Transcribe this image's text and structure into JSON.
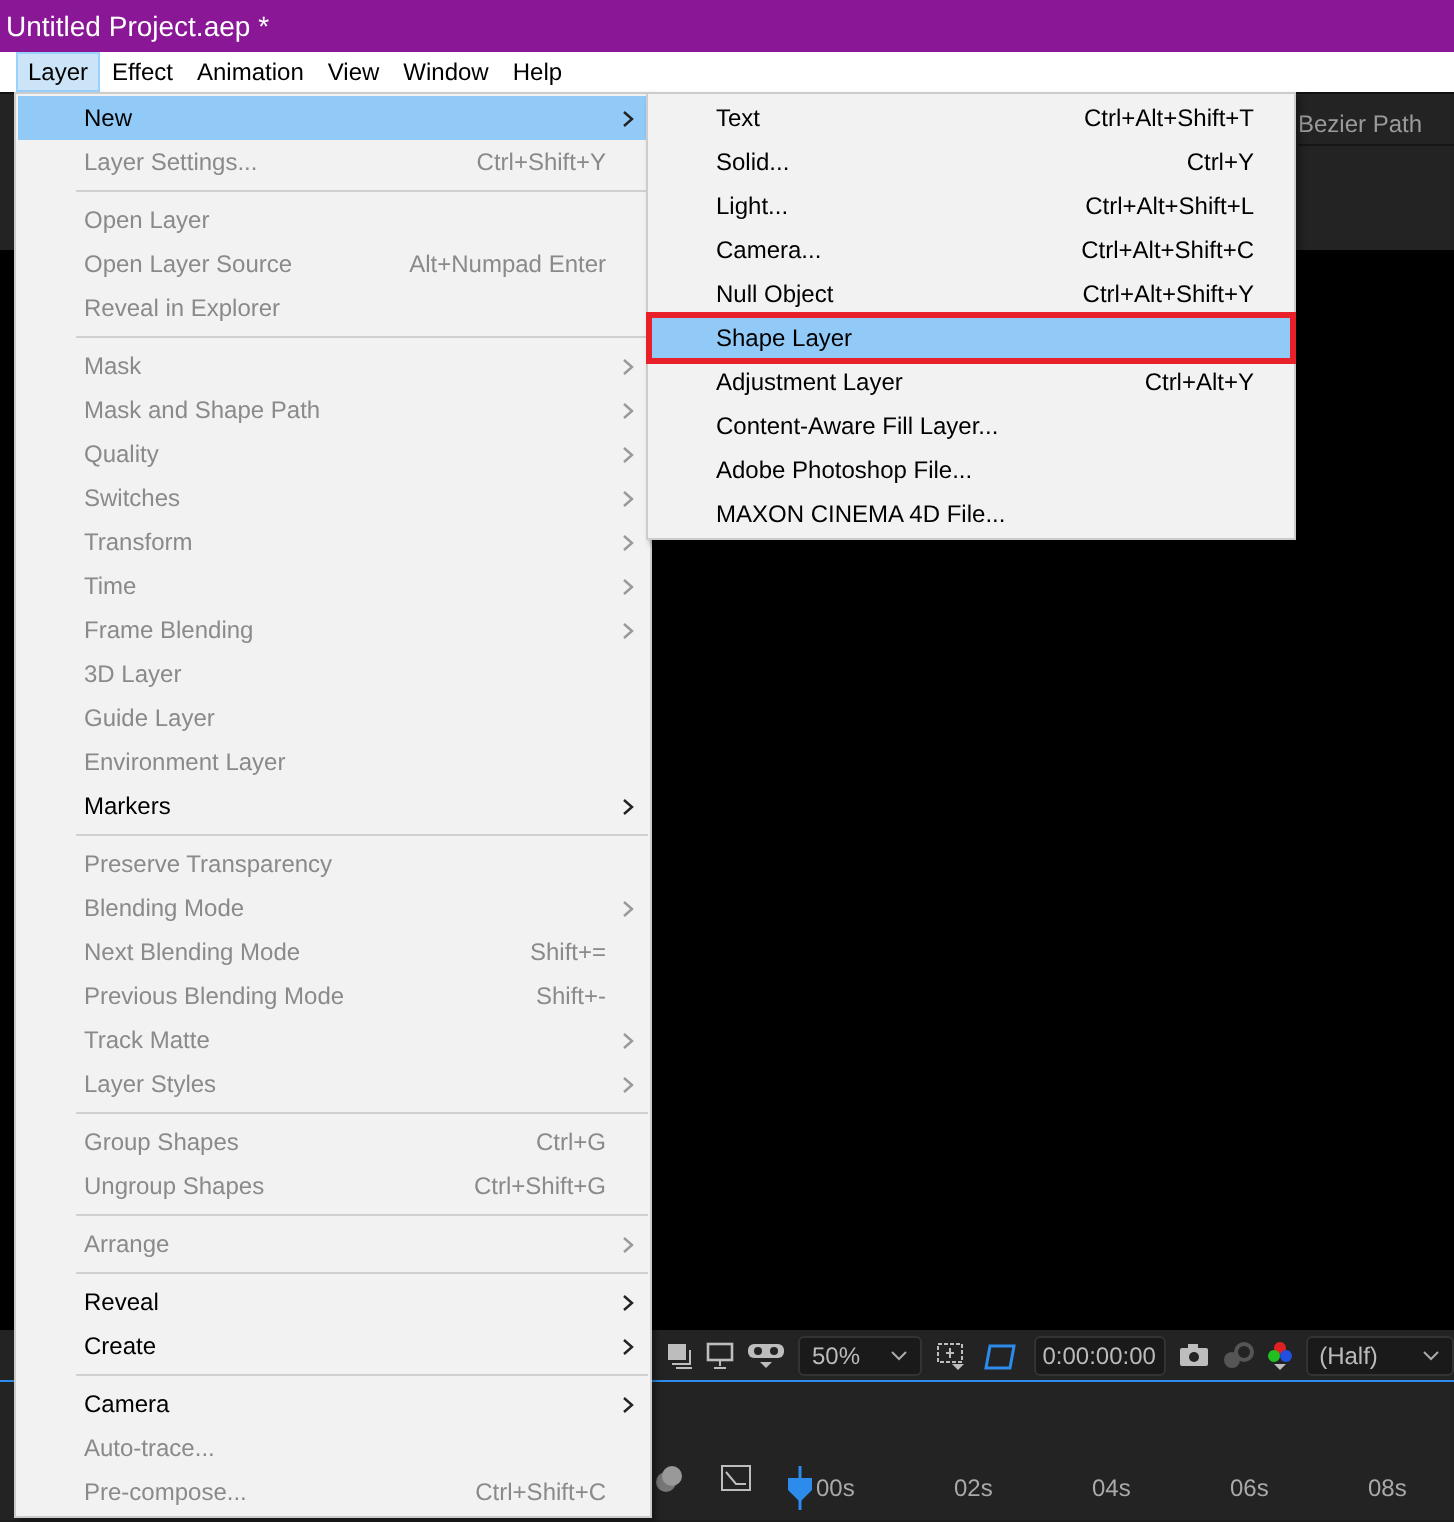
{
  "title_bar": {
    "title": "Untitled Project.aep *"
  },
  "menu_bar": [
    {
      "label": "Layer",
      "selected": true
    },
    {
      "label": "Effect",
      "selected": false
    },
    {
      "label": "Animation",
      "selected": false
    },
    {
      "label": "View",
      "selected": false
    },
    {
      "label": "Window",
      "selected": false
    },
    {
      "label": "Help",
      "selected": false
    }
  ],
  "layer_menu": [
    {
      "kind": "item",
      "label": "New",
      "submenu": true,
      "disabled": false,
      "selected": true
    },
    {
      "kind": "item",
      "label": "Layer Settings...",
      "shortcut": "Ctrl+Shift+Y",
      "disabled": true,
      "selected": false
    },
    {
      "kind": "separator"
    },
    {
      "kind": "item",
      "label": "Open Layer",
      "disabled": true,
      "selected": false
    },
    {
      "kind": "item",
      "label": "Open Layer Source",
      "shortcut": "Alt+Numpad Enter",
      "disabled": true,
      "selected": false
    },
    {
      "kind": "item",
      "label": "Reveal in Explorer",
      "disabled": true,
      "selected": false
    },
    {
      "kind": "separator"
    },
    {
      "kind": "item",
      "label": "Mask",
      "submenu": true,
      "disabled": true,
      "selected": false
    },
    {
      "kind": "item",
      "label": "Mask and Shape Path",
      "submenu": true,
      "disabled": true,
      "selected": false
    },
    {
      "kind": "item",
      "label": "Quality",
      "submenu": true,
      "disabled": true,
      "selected": false
    },
    {
      "kind": "item",
      "label": "Switches",
      "submenu": true,
      "disabled": true,
      "selected": false
    },
    {
      "kind": "item",
      "label": "Transform",
      "submenu": true,
      "disabled": true,
      "selected": false
    },
    {
      "kind": "item",
      "label": "Time",
      "submenu": true,
      "disabled": true,
      "selected": false
    },
    {
      "kind": "item",
      "label": "Frame Blending",
      "submenu": true,
      "disabled": true,
      "selected": false
    },
    {
      "kind": "item",
      "label": "3D Layer",
      "disabled": true,
      "selected": false
    },
    {
      "kind": "item",
      "label": "Guide Layer",
      "disabled": true,
      "selected": false
    },
    {
      "kind": "item",
      "label": "Environment Layer",
      "disabled": true,
      "selected": false
    },
    {
      "kind": "item",
      "label": "Markers",
      "submenu": true,
      "disabled": false,
      "selected": false
    },
    {
      "kind": "separator"
    },
    {
      "kind": "item",
      "label": "Preserve Transparency",
      "disabled": true,
      "selected": false
    },
    {
      "kind": "item",
      "label": "Blending Mode",
      "submenu": true,
      "disabled": true,
      "selected": false
    },
    {
      "kind": "item",
      "label": "Next Blending Mode",
      "shortcut": "Shift+=",
      "disabled": true,
      "selected": false
    },
    {
      "kind": "item",
      "label": "Previous Blending Mode",
      "shortcut": "Shift+-",
      "disabled": true,
      "selected": false
    },
    {
      "kind": "item",
      "label": "Track Matte",
      "submenu": true,
      "disabled": true,
      "selected": false
    },
    {
      "kind": "item",
      "label": "Layer Styles",
      "submenu": true,
      "disabled": true,
      "selected": false
    },
    {
      "kind": "separator"
    },
    {
      "kind": "item",
      "label": "Group Shapes",
      "shortcut": "Ctrl+G",
      "disabled": true,
      "selected": false
    },
    {
      "kind": "item",
      "label": "Ungroup Shapes",
      "shortcut": "Ctrl+Shift+G",
      "disabled": true,
      "selected": false
    },
    {
      "kind": "separator"
    },
    {
      "kind": "item",
      "label": "Arrange",
      "submenu": true,
      "disabled": true,
      "selected": false
    },
    {
      "kind": "separator"
    },
    {
      "kind": "item",
      "label": "Reveal",
      "submenu": true,
      "disabled": false,
      "selected": false
    },
    {
      "kind": "item",
      "label": "Create",
      "submenu": true,
      "disabled": false,
      "selected": false
    },
    {
      "kind": "separator"
    },
    {
      "kind": "item",
      "label": "Camera",
      "submenu": true,
      "disabled": false,
      "selected": false
    },
    {
      "kind": "item",
      "label": "Auto-trace...",
      "disabled": true,
      "selected": false
    },
    {
      "kind": "item",
      "label": "Pre-compose...",
      "shortcut": "Ctrl+Shift+C",
      "disabled": true,
      "selected": false
    }
  ],
  "new_submenu": [
    {
      "label": "Text",
      "shortcut": "Ctrl+Alt+Shift+T",
      "selected": false,
      "outlined": false
    },
    {
      "label": "Solid...",
      "shortcut": "Ctrl+Y",
      "selected": false,
      "outlined": false
    },
    {
      "label": "Light...",
      "shortcut": "Ctrl+Alt+Shift+L",
      "selected": false,
      "outlined": false
    },
    {
      "label": "Camera...",
      "shortcut": "Ctrl+Alt+Shift+C",
      "selected": false,
      "outlined": false
    },
    {
      "label": "Null Object",
      "shortcut": "Ctrl+Alt+Shift+Y",
      "selected": false,
      "outlined": false
    },
    {
      "label": "Shape Layer",
      "selected": true,
      "outlined": true
    },
    {
      "label": "Adjustment Layer",
      "shortcut": "Ctrl+Alt+Y",
      "selected": false,
      "outlined": false
    },
    {
      "label": "Content-Aware Fill Layer...",
      "selected": false,
      "outlined": false
    },
    {
      "label": "Adobe Photoshop File...",
      "selected": false,
      "outlined": false
    },
    {
      "label": "MAXON CINEMA 4D File...",
      "selected": false,
      "outlined": false
    }
  ],
  "panel": {
    "tab": "Bezier Path"
  },
  "viewer_toolbar": {
    "zoom": "50%",
    "timecode": "0:00:00:00",
    "resolution": "(Half)"
  },
  "timeline": {
    "ruler": [
      "00s",
      "02s",
      "04s",
      "06s",
      "08s"
    ]
  }
}
